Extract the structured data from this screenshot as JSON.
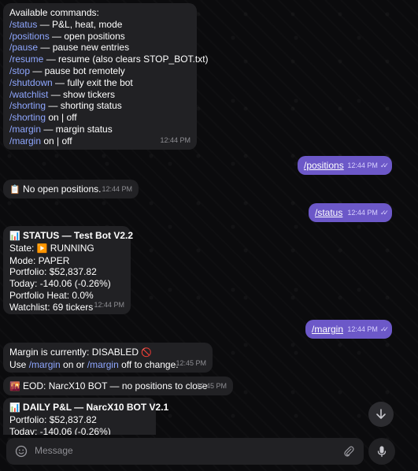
{
  "messages": {
    "commands": {
      "title": "Available commands:",
      "items": [
        {
          "cmd": "/status",
          "text": " — P&L, heat, mode"
        },
        {
          "cmd": "/positions",
          "text": " — open positions"
        },
        {
          "cmd": "/pause",
          "text": " — pause new entries"
        },
        {
          "cmd": "/resume",
          "text": " — resume (also clears STOP_BOT.txt)"
        },
        {
          "cmd": "/stop",
          "text": " — pause bot remotely"
        },
        {
          "cmd": "/shutdown",
          "text": " — fully exit the bot"
        },
        {
          "cmd": "/watchlist",
          "text": " — show tickers"
        },
        {
          "cmd": "/shorting",
          "text": " — shorting status"
        },
        {
          "cmd": "/shorting",
          "text": " on | off"
        },
        {
          "cmd": "/margin",
          "text": " — margin status"
        },
        {
          "cmd": "/margin",
          "text": " on | off"
        }
      ],
      "time": "12:44 PM"
    },
    "out_positions": {
      "text": "/positions",
      "time": "12:44 PM",
      "ticks": "✓✓"
    },
    "no_positions": {
      "emoji": "📋",
      "text": "No open positions.",
      "time": "12:44 PM"
    },
    "out_status": {
      "text": "/status",
      "time": "12:44 PM",
      "ticks": "✓✓"
    },
    "status": {
      "emoji": "📊",
      "title": "STATUS — Test Bot V2.2",
      "state_label": "State:",
      "state_emoji": "▶️",
      "state_value": "RUNNING",
      "mode": "Mode: PAPER",
      "portfolio": "Portfolio: $52,837.82",
      "today": "Today: -140.06 (-0.26%)",
      "heat": "Portfolio Heat: 0.0%",
      "watchlist": "Watchlist: 69 tickers",
      "time": "12:44 PM"
    },
    "out_margin": {
      "text": "/margin",
      "time": "12:44 PM",
      "ticks": "✓✓"
    },
    "margin": {
      "line1": "Margin is currently: DISABLED",
      "line1_emoji": "🚫",
      "use": "Use",
      "cmd1": "/margin",
      "mid": "on or",
      "cmd2": "/margin",
      "end": "off to change.",
      "time": "12:45 PM"
    },
    "eod": {
      "emoji": "🌇",
      "text": "EOD: NarcX10 BOT — no positions to close",
      "time": "12:45 PM"
    },
    "daily": {
      "emoji": "📊",
      "title": "DAILY P&L — NarcX10 BOT V2.1",
      "portfolio": "Portfolio: $52,837.82",
      "today": "Today: -140.06 (-0.26%)"
    }
  },
  "composer": {
    "placeholder": "Message"
  },
  "icons": {
    "emoji": "emoji-icon",
    "attach": "paperclip-icon",
    "mic": "microphone-icon",
    "scroll": "chevron-down-icon"
  },
  "colors": {
    "background": "#0b0b0d",
    "incoming": "#212124",
    "outgoing": "#6c58c8",
    "link": "#8fa7ff",
    "time": "#8e8e93"
  }
}
